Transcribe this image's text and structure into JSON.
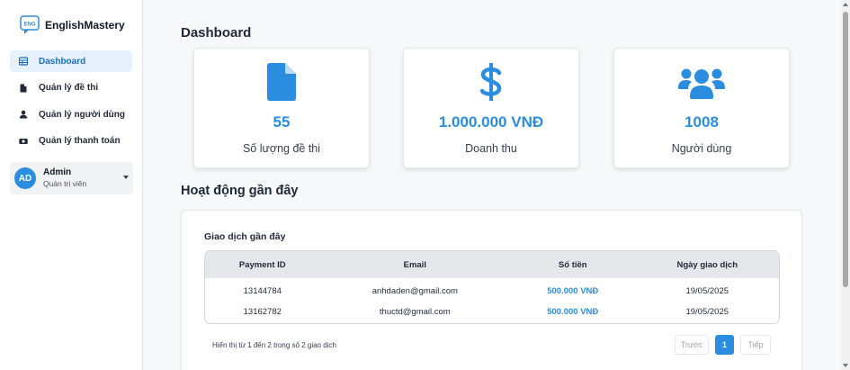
{
  "app": {
    "name": "EnglishMastery",
    "logo_text": "ENG"
  },
  "sidebar": {
    "items": [
      {
        "label": "Dashboard",
        "icon": "table-icon",
        "active": true
      },
      {
        "label": "Quản lý đề thi",
        "icon": "file-icon",
        "active": false
      },
      {
        "label": "Quản lý người dùng",
        "icon": "user-icon",
        "active": false
      },
      {
        "label": "Quản lý thanh toán",
        "icon": "money-bill-icon",
        "active": false
      }
    ],
    "user": {
      "initials": "AD",
      "name": "Admin",
      "role": "Quản trị viên"
    }
  },
  "page": {
    "title": "Dashboard"
  },
  "stats": [
    {
      "value": "55",
      "label": "Số lượng đề thi",
      "icon": "file-icon"
    },
    {
      "value": "1.000.000 VNĐ",
      "label": "Doanh thu",
      "icon": "dollar-icon"
    },
    {
      "value": "1008",
      "label": "Người dùng",
      "icon": "users-icon"
    }
  ],
  "activity": {
    "title": "Hoạt động gần đây",
    "panel_title": "Giao dịch gần đây",
    "columns": [
      "Payment ID",
      "Email",
      "Số tiền",
      "Ngày giao dịch"
    ],
    "rows": [
      [
        "13144784",
        "anhdaden@gmail.com",
        "500.000 VNĐ",
        "19/05/2025"
      ],
      [
        "13162782",
        "thuctd@gmail.com",
        "500.000 VNĐ",
        "19/05/2025"
      ]
    ],
    "pagination": {
      "info": "Hiển thị từ 1 đến 2 trong số 2 giao dịch",
      "prev": "Trước",
      "current": "1",
      "next": "Tiếp"
    }
  },
  "colors": {
    "accent": "#2b8de0",
    "active_bg": "#e6f1fb",
    "header_bg": "#e5e7eb"
  }
}
